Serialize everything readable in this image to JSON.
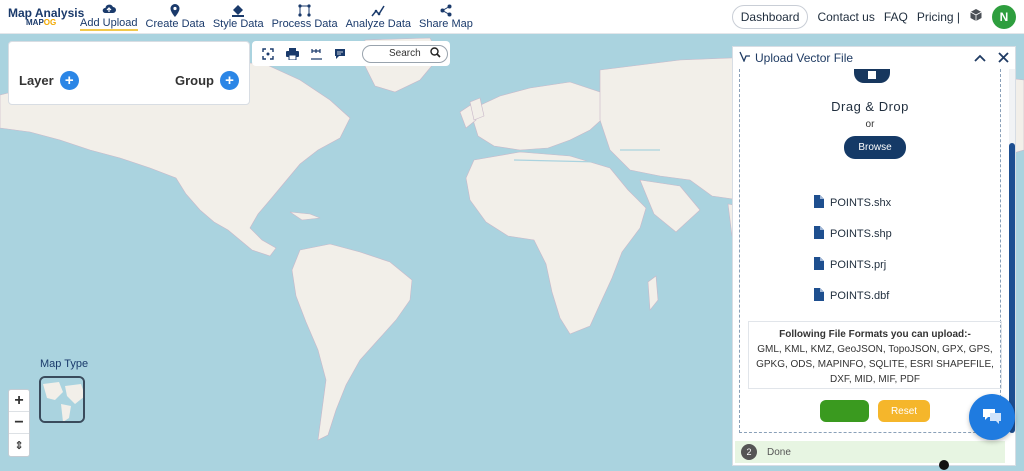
{
  "brand": {
    "title": "Map Analysis",
    "subtitle_main": "MAP",
    "subtitle_accent": "OG"
  },
  "nav": [
    {
      "label": "Add Upload",
      "icon": "cloud-upload-icon",
      "active": true
    },
    {
      "label": "Create Data",
      "icon": "map-pin-icon"
    },
    {
      "label": "Style Data",
      "icon": "paint-bucket-icon"
    },
    {
      "label": "Process Data",
      "icon": "process-nodes-icon"
    },
    {
      "label": "Analyze Data",
      "icon": "analyze-chart-icon"
    },
    {
      "label": "Share Map",
      "icon": "share-icon"
    }
  ],
  "header_right": {
    "dashboard": "Dashboard",
    "contact": "Contact us",
    "faq": "FAQ",
    "pricing": "Pricing |",
    "avatar_initial": "N"
  },
  "layer_panel": {
    "layer_label": "Layer",
    "group_label": "Group"
  },
  "toolbar": {
    "search_label": "Search"
  },
  "map_controls": {
    "zoom_in": "+",
    "zoom_out": "−",
    "reset_north": "⇕",
    "map_type_label": "Map Type"
  },
  "upload_panel": {
    "title": "Upload Vector File",
    "drag_drop": "Drag & Drop",
    "or": "or",
    "browse": "Browse",
    "files": [
      "POINTS.shx",
      "POINTS.shp",
      "POINTS.prj",
      "POINTS.dbf"
    ],
    "formats_heading": "Following File Formats you can upload:-",
    "formats_list": "GML, KML, KMZ, GeoJSON, TopoJSON, GPX, GPS, GPKG, ODS, MAPINFO, SQLITE, ESRI SHAPEFILE, DXF, MID, MIF, PDF",
    "reset": "Reset",
    "status_step": "2",
    "status_text": "Done"
  },
  "colors": {
    "brand_navy": "#1a3a6b",
    "accent_yellow": "#f2c94c",
    "upload_green": "#3a9a1f",
    "reset_orange": "#f5b62b",
    "water": "#aad3df",
    "land": "#f2efe9"
  }
}
